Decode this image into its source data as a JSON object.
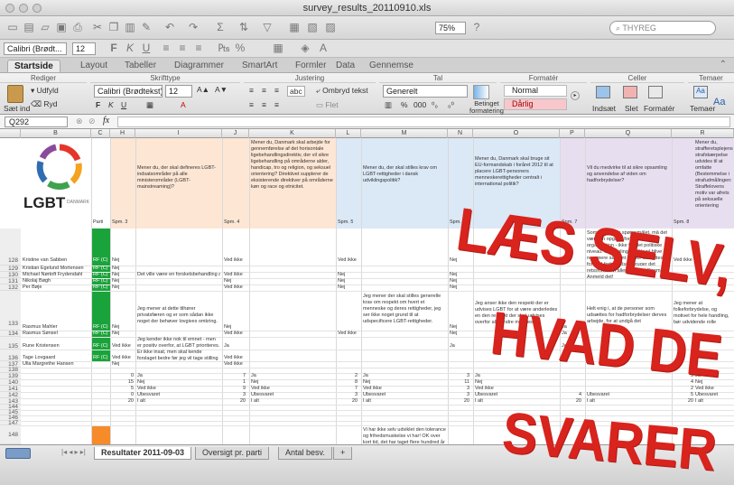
{
  "window": {
    "title": "survey_results_20110910.xls"
  },
  "toolbar": {
    "zoom": "75%",
    "search_placeholder": "THYREG"
  },
  "fontrow": {
    "font": "Calibri (Brødt...",
    "size": "12"
  },
  "ribbon_tabs": [
    "Startside",
    "Layout",
    "Tabeller",
    "Diagrammer",
    "SmartArt",
    "Formler",
    "Data",
    "Gennemse"
  ],
  "ribbon": {
    "groups": [
      "Rediger",
      "Skrifttype",
      "Justering",
      "Tal",
      "Formatér",
      "Celler",
      "Temaer"
    ],
    "fill_label": "Udfyld",
    "clear_label": "Ryd",
    "paste_label": "Sæt ind",
    "font": "Calibri (Brødtekst)",
    "size": "12",
    "wrap_label": "Ombryd tekst",
    "number_format": "Generelt",
    "cond_format_line1": "Betinget",
    "cond_format_line2": "formatering",
    "style_normal": "Normal",
    "style_bad": "Dårlig",
    "insert_label": "Indsæt",
    "delete_label": "Slet",
    "format_label": "Formatér",
    "themes_label": "Temaer",
    "merge_label": "Flet",
    "abc_label": "abc"
  },
  "formula": {
    "cell_ref": "Q292",
    "fx": "fx"
  },
  "columns": [
    "B",
    "C",
    "H",
    "I",
    "J",
    "K",
    "L",
    "M",
    "N",
    "O",
    "P",
    "Q",
    "R"
  ],
  "logo": {
    "text": "LGBT",
    "sub": "DANMARK"
  },
  "headers": {
    "parti": "Parti",
    "spm3": "Spm. 3",
    "q_h": "Mener du, der skal defineres LGBT-indsatsområder på alle ministerområder (LGBT-mainstreaming)?",
    "spm4": "Spm. 4",
    "q_j": "Mener du, Danmark skal arbejde for gennemførelse af det horisontale ligebehandlingsdirektiv, der vil sikre ligebehandling på områderne alder, handicap, tro og religion, og seksuel orientering? Direktivet supplerer de eksisterende direktiver på områderne køn og race og etnicitet.",
    "spm5": "Spm. 5",
    "q_m": "Mener du, der skal stilles krav om LGBT-rettigheder i dansk udviklingspolitik?",
    "spm6": "Spm. 6",
    "q_o": "Mener du, Danmark skal bruge sit EU-formandskab i foråret 2012 til at placere LGBT-personers menneskerettigheder centralt i international politik?",
    "spm7": "Spm. 7",
    "q_q": "Vil du medvirke til at sikre opsamling og anvendelse af viden om hadforbrydelser?",
    "spm8": "Spm. 8",
    "q_s": "Mener du, strafferetsplejens strafskærpelse udvides til at omfatte (Bestemmelse i strafudmålingen: Straffelovens motiv var afrets på seksuelle orientering"
  },
  "rows": [
    {
      "n": "128",
      "name": "Kristine van Sabben",
      "h": "Nej",
      "i": "",
      "j": "Ved ikke",
      "m": "Ved ikke",
      "n2": "Nej",
      "o": "",
      "p": "Nej",
      "r": "Ved ikke"
    },
    {
      "n": "129",
      "name": "Kristian Egelund Mortensen",
      "h": "Nej",
      "i": "",
      "j": "",
      "m": "",
      "n2": "",
      "o": "",
      "p": "",
      "r": ""
    },
    {
      "n": "130",
      "name": "Michael Nørtoft Frydendahl",
      "h": "Nej",
      "i": "Det ville være en forskelsbehandling af",
      "j": "Ved ikke",
      "m": "Nej",
      "n2": "Nej",
      "o": "",
      "p": "",
      "r": ""
    },
    {
      "n": "131",
      "name": "Nikolaj Bøgh",
      "h": "Nej",
      "i": "",
      "j": "Nej",
      "m": "Nej",
      "n2": "Nej",
      "o": "",
      "p": "",
      "r": ""
    },
    {
      "n": "132",
      "name": "Per Bøje",
      "h": "Nej",
      "i": "",
      "j": "Ved ikke",
      "m": "Nej",
      "n2": "Nej",
      "o": "",
      "p": "",
      "r": ""
    },
    {
      "n": "133",
      "name": "Rasmus Mahler",
      "h": "Nej",
      "i": "",
      "j": "Nej",
      "m": "",
      "n2": "Nej",
      "o": "",
      "p": "Ja",
      "r": ""
    },
    {
      "n": "134",
      "name": "Rasmus Sønsel",
      "h": "Nej",
      "i": "",
      "j": "Ved ikke",
      "m": "Ved ikke",
      "n2": "Nej",
      "o": "",
      "p": "Ja",
      "r": ""
    },
    {
      "n": "135",
      "name": "Rune Kristensen",
      "h": "Ved ikke",
      "i": "Jeg kender ikke nok til emnet - men er positiv overfor, at LGBT prioriteres.",
      "j": "Ja",
      "m": "",
      "n2": "Ja",
      "o": "",
      "p": "Ja",
      "r": ""
    },
    {
      "n": "136",
      "name": "Tage Lovgaard",
      "h": "Ved ikke",
      "i": "Er ikke insat, men skal kende forslaget bedre før jeg vil tage stilling",
      "j": "Ved ikke",
      "m": "",
      "n2": "",
      "o": "",
      "p": "",
      "r": ""
    },
    {
      "n": "137",
      "name": "Ulla Margrethe Hansen",
      "h": "Nej",
      "i": "",
      "j": "Ved ikke",
      "m": "",
      "n2": "",
      "o": "",
      "p": "",
      "r": ""
    }
  ],
  "party_code": "RF (C)",
  "long_texts": {
    "q_top": "Som jeg forstår spørgsmålet, må det være en opgave for jeres organisation - ikke for det politiske niveau. Indsamlingen vil kunl blive nemmere såfremt de der udsættes for had-forbrydelser, bruger det retssystem vi allerede har i Danmark. Anmeld det!",
    "i_133": "Jeg mener at dette tilhører privatsfæren og er som sådan ikke noget der behøver lovgives omkring.",
    "m_133": "Jeg mener der skal stilles generelle krav om respekt om hvert et menneske og deres rettigheder, jeg ser ikke noget grund til at udspecificere LGBT-rettigheder.",
    "o_133": "Jeg anser ikke den respekt der er udvises LGBT for at være anderledes en den respekt der skal udvises overfor alle andre mennesker.",
    "q_133": "Helt enig i, at de personer som udsættes for hadforbrydelser derves arbejde, for at undgå det",
    "s_133": "Jeg mener at folkeforbrydelse, og motivet for hele handling, bør udvidende rolle",
    "m_148": "Vi har ikke selv udviklet den tolerance og frihedsmuskelse vi har! OK over kort tid, det har taget flere hundred år"
  },
  "summary": [
    {
      "n": "139",
      "cnt": "0",
      "lbl": "Ja",
      "j": "7",
      "jl": "Ja",
      "m": "2",
      "ml": "Ja",
      "o": "3",
      "ol": "Ja",
      "s": "9",
      "sl": "Ja"
    },
    {
      "n": "140",
      "cnt": "15",
      "lbl": "Nej",
      "j": "1",
      "jl": "Nej",
      "m": "8",
      "ml": "Nej",
      "o": "11",
      "ol": "Nej",
      "s": "4",
      "sl": "Nej"
    },
    {
      "n": "141",
      "cnt": "5",
      "lbl": "Ved ikke",
      "j": "9",
      "jl": "Ved ikke",
      "m": "7",
      "ml": "Ved ikke",
      "o": "3",
      "ol": "Ved ikke",
      "s": "2",
      "sl": "Ved ikke"
    },
    {
      "n": "142",
      "cnt": "0",
      "lbl": "Ubesvaret",
      "j": "3",
      "jl": "Ubesvaret",
      "m": "3",
      "ml": "Ubesvaret",
      "o": "3",
      "ol": "Ubesvaret",
      "q": "4",
      "ql": "Ubesvaret",
      "s": "5",
      "sl": "Ubesvaret"
    },
    {
      "n": "143",
      "cnt": "20",
      "lbl": "I alt",
      "j": "20",
      "jl": "I alt",
      "m": "20",
      "ml": "I alt",
      "o": "20",
      "ol": "I alt",
      "q": "20",
      "ql": "I alt",
      "s": "20",
      "sl": "I alt"
    }
  ],
  "empty_rows": [
    "138",
    "144",
    "145",
    "146",
    "147",
    "148"
  ],
  "sheet_tabs": [
    "Resultater 2011-09-03",
    "Oversigt pr. parti",
    "Antal besv."
  ],
  "overlay": {
    "line1": "LÆS SELV,",
    "line2": "HVAD DE",
    "line3": "SVARER"
  },
  "colors": {
    "party_green": "#1aa33a",
    "stamp_red": "#d9231d",
    "header_peach": "#fde6d4",
    "header_blue": "#dbe8f6",
    "header_lilac": "#e7dff0",
    "bad_style": "#f8c7cb",
    "orange_cell": "#f68b2a"
  }
}
